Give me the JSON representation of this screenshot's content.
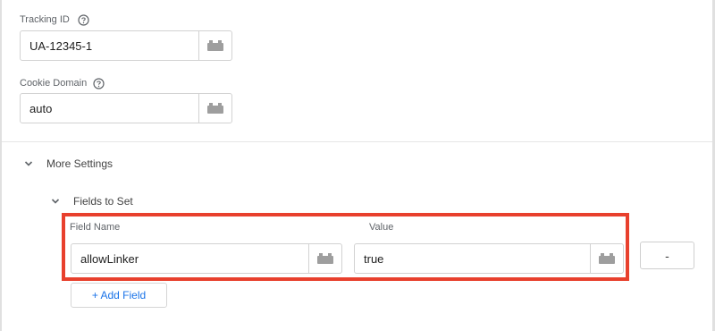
{
  "tracking_id": {
    "label": "Tracking ID",
    "value": "UA-12345-1"
  },
  "cookie_domain": {
    "label": "Cookie Domain",
    "value": "auto"
  },
  "more_settings": {
    "label": "More Settings"
  },
  "fields_to_set": {
    "label": "Fields to Set",
    "column_field_name": "Field Name",
    "column_value": "Value",
    "rows": [
      {
        "field_name": "allowLinker",
        "value": "true",
        "remove_label": "-"
      }
    ],
    "add_field_label": "+ Add Field"
  },
  "colors": {
    "highlight": "#e8402d",
    "link": "#1a73e8"
  },
  "icons": {
    "help": "help-circle-icon",
    "variable": "variable-lego-icon",
    "chevron": "chevron-down-icon"
  }
}
